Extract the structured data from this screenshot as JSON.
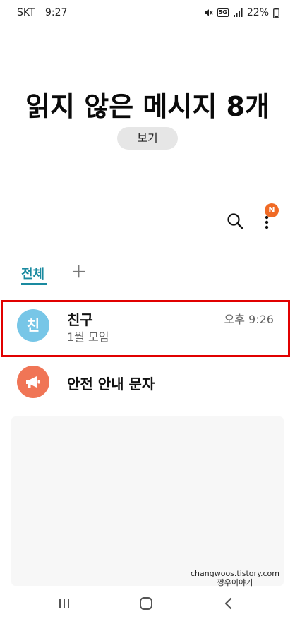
{
  "status_bar": {
    "carrier": "SKT",
    "time": "9:27",
    "network": "5G",
    "battery": "22%"
  },
  "header": {
    "title": "읽지 않은 메시지 8개",
    "view_button": "보기"
  },
  "toolbar": {
    "notification_badge": "N"
  },
  "tabs": {
    "all": "전체",
    "add": "+"
  },
  "conversations": [
    {
      "avatar_text": "친",
      "name": "친구",
      "time": "오후 9:26",
      "preview": "1월 모임",
      "avatar_color": "#77c6e7"
    },
    {
      "name": "안전 안내 문자",
      "avatar_color": "#f07556",
      "icon": "megaphone-icon"
    }
  ],
  "watermark": {
    "line1": "changwoos.tistory.com",
    "line2": "짱우이야기"
  },
  "colors": {
    "accent": "#1a8aa0",
    "badge": "#f06a25",
    "highlight_border": "#e10000"
  }
}
